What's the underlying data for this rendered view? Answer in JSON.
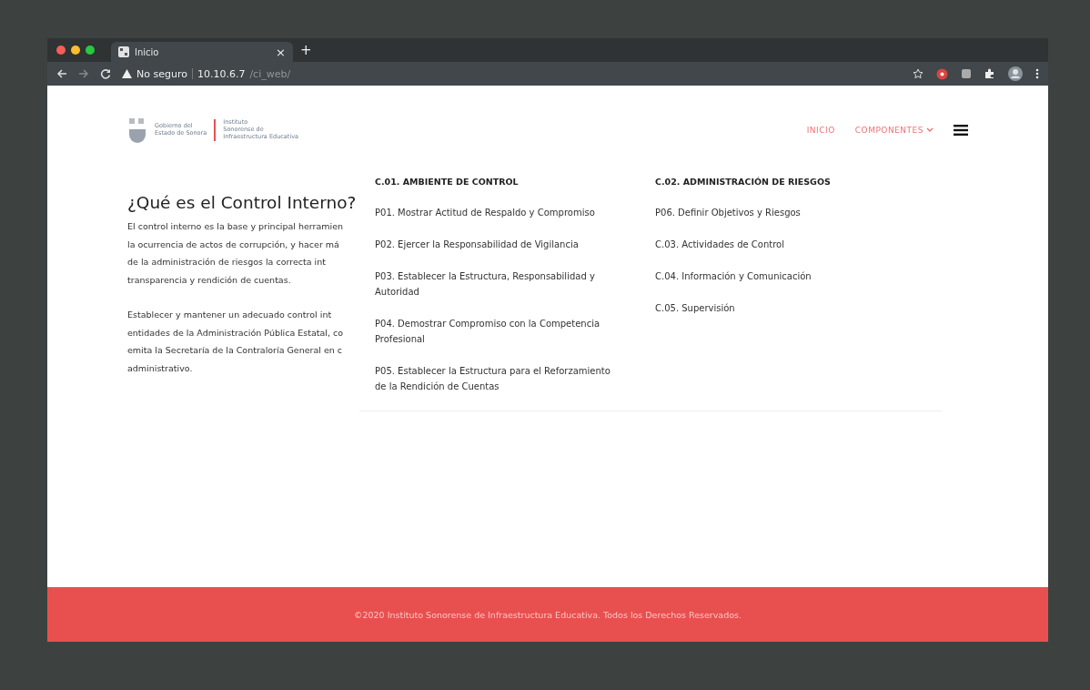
{
  "browser": {
    "tab_title": "Inicio",
    "tab_close": "×",
    "new_tab": "+",
    "security_label": "No seguro",
    "url_host": "10.10.6.7",
    "url_path": "/ci_web/"
  },
  "header": {
    "logo_left": [
      "Gobierno del",
      "Estado de Sonora"
    ],
    "logo_right": [
      "Instituto",
      "Sonorense de",
      "Infraestructura Educativa"
    ],
    "nav": [
      {
        "label": "INICIO",
        "kind": "link"
      },
      {
        "label": "COMPONENTES",
        "kind": "dropdown"
      }
    ]
  },
  "intro": {
    "title": "¿Qué es el Control Interno?",
    "paragraphs": [
      [
        "El control interno es la base y principal herramien",
        "la ocurrencia de actos de corrupción, y hacer má",
        "de la administración de riesgos la correcta int",
        "transparencia y rendición de cuentas."
      ],
      [
        "Establecer y mantener un adecuado control int",
        "entidades de la Administración Pública Estatal, co",
        "emita la Secretaría de la Contraloría General en c",
        "administrativo."
      ]
    ]
  },
  "sections": [
    {
      "heading": "C.01. AMBIENTE DE CONTROL",
      "items": [
        "P01. Mostrar Actitud de Respaldo y Compromiso",
        "P02. Ejercer la Responsabilidad de Vigilancia",
        "P03. Establecer la Estructura, Responsabilidad y Autoridad",
        "P04. Demostrar Compromiso con la Competencia Profesional",
        "P05. Establecer la Estructura para el Reforzamiento de la Rendición de Cuentas"
      ]
    },
    {
      "heading": "C.02. ADMINISTRACIÓN DE RIESGOS",
      "items": [
        "P06. Definir Objetivos y Riesgos",
        "C.03. Actividades de Control",
        "C.04. Información y Comunicación",
        "C.05. Supervisión"
      ]
    }
  ],
  "footer": "©2020 Instituto Sonorense de Infraestructura Educativa. Todos los Derechos Reservados."
}
